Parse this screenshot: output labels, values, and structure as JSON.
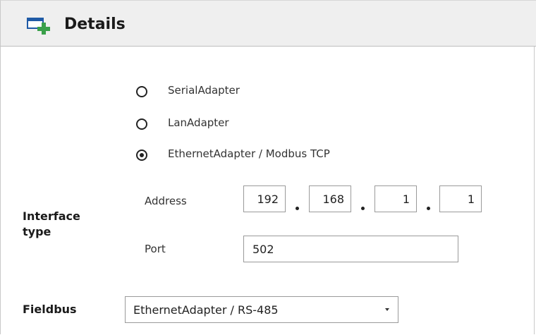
{
  "header": {
    "title": "Details",
    "icon": "add-window-icon",
    "icon_color": "#3aa04a"
  },
  "interface_type": {
    "label": "Interface type",
    "options": [
      {
        "label": "SerialAdapter",
        "selected": false
      },
      {
        "label": "LanAdapter",
        "selected": false
      },
      {
        "label": "EthernetAdapter / Modbus TCP",
        "selected": true
      }
    ],
    "address": {
      "label": "Address",
      "octets": [
        "192",
        "168",
        "1",
        "1"
      ]
    },
    "port": {
      "label": "Port",
      "value": "502"
    }
  },
  "fieldbus": {
    "label": "Fieldbus",
    "selected": "EthernetAdapter / RS-485"
  }
}
